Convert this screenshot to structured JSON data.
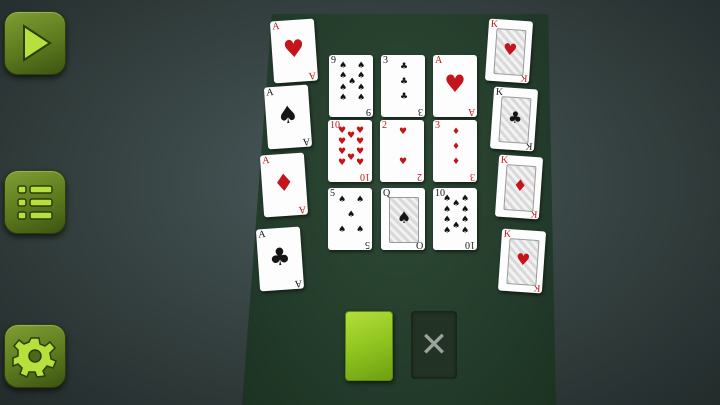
{
  "sidebar": [
    {
      "name": "play-button",
      "icon": "play-icon"
    },
    {
      "name": "menu-button",
      "icon": "list-menu-icon"
    },
    {
      "name": "settings-button",
      "icon": "gear-icon"
    }
  ],
  "discard_symbol": "✕",
  "cards": [
    {
      "rank": "A",
      "suit": "♥",
      "color": "red",
      "kind": "ace"
    },
    {
      "rank": "A",
      "suit": "♠",
      "color": "blk",
      "kind": "ace"
    },
    {
      "rank": "A",
      "suit": "♦",
      "color": "red",
      "kind": "ace"
    },
    {
      "rank": "A",
      "suit": "♣",
      "color": "blk",
      "kind": "ace"
    },
    {
      "rank": "K",
      "suit": "♥",
      "color": "red",
      "kind": "face"
    },
    {
      "rank": "K",
      "suit": "♣",
      "color": "blk",
      "kind": "face"
    },
    {
      "rank": "K",
      "suit": "♦",
      "color": "red",
      "kind": "face"
    },
    {
      "rank": "K",
      "suit": "♥",
      "color": "red",
      "kind": "face"
    },
    {
      "rank": "9",
      "suit": "♠",
      "color": "blk",
      "kind": "pips",
      "n": 9
    },
    {
      "rank": "3",
      "suit": "♣",
      "color": "blk",
      "kind": "pips",
      "n": 3
    },
    {
      "rank": "A",
      "suit": "♥",
      "color": "red",
      "kind": "ace"
    },
    {
      "rank": "10",
      "suit": "♥",
      "color": "red",
      "kind": "pips",
      "n": 10
    },
    {
      "rank": "2",
      "suit": "♥",
      "color": "red",
      "kind": "pips",
      "n": 2
    },
    {
      "rank": "3",
      "suit": "♦",
      "color": "red",
      "kind": "pips",
      "n": 3
    },
    {
      "rank": "5",
      "suit": "♠",
      "color": "blk",
      "kind": "pips",
      "n": 5
    },
    {
      "rank": "Q",
      "suit": "♠",
      "color": "blk",
      "kind": "face"
    },
    {
      "rank": "10",
      "suit": "♠",
      "color": "blk",
      "kind": "pips",
      "n": 10
    }
  ]
}
